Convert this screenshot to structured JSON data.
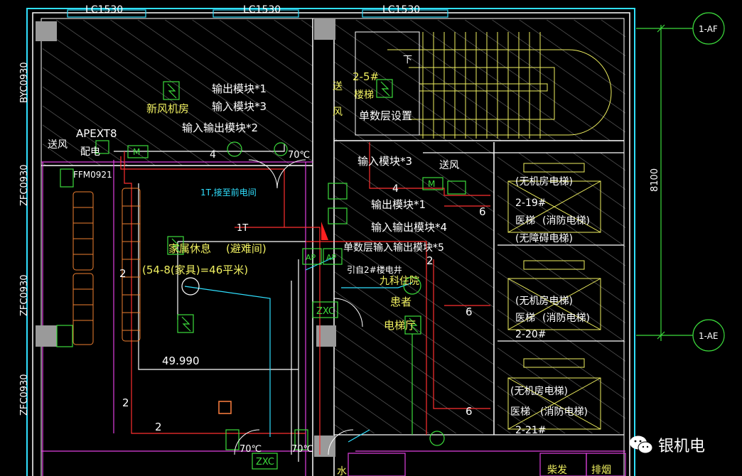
{
  "colors": {
    "background": "#000000",
    "wall": "#ffffff",
    "hatch": "#6b6b6b",
    "text_yellow": "#f0f060",
    "text_green": "#3cdc3c",
    "text_cyan": "#30e0ff",
    "text_white": "#ffffff",
    "magenta": "#e040e0",
    "red": "#ff3030",
    "dark_cyan": "#1aa6a6"
  },
  "windows": {
    "top": [
      "LC1530",
      "LC1530",
      "LC1530"
    ]
  },
  "left_labels": {
    "l1": "BYC0930",
    "l2": "ZFC0930",
    "l3": "ZFC0930",
    "l4": "ZFC0930",
    "l5": "ZFC0930"
  },
  "axes": {
    "a1": "1-AF",
    "a2": "1-AE",
    "dim": "8100"
  },
  "room_labels": {
    "xinfeng": "新风机房",
    "songfeng_left": "送风",
    "peidian": "配电",
    "apex": "APEXT8",
    "fm": "FFM0921",
    "jiashu": "家属休息",
    "bipan": "(避难间)",
    "area": "(54-8(家具)=46平米)",
    "elev_dim": "49.990",
    "songfeng_top": "送",
    "feng_top": "风",
    "stair_no": "2-5#",
    "louti": "楼梯",
    "xia": "下",
    "songfeng_mid": "送风",
    "huanzhe": "患者",
    "diantiting": "电梯厅",
    "jiyiyuan": "九科住院",
    "yindao": "引自2#楼电井",
    "t_route": "1T,接至前电间",
    "t_mark": "1T"
  },
  "notes": {
    "n1": "输出模块*1",
    "n2": "输入模块*3",
    "n3": "输入输出模块*2",
    "n4": "单数层设置",
    "n5": "输入模块*3",
    "n6": "输出模块*1",
    "n7": "输入输出模块*4",
    "n8": "单数层输入输出模块*5"
  },
  "temps": {
    "t1": "70℃",
    "t2": "70℃",
    "t3": "70℃"
  },
  "elevators": [
    {
      "type": "(无机房电梯)",
      "name": "医梯",
      "fire": "(消防电梯)",
      "no": "2-19#",
      "extra": "(无障碍电梯)"
    },
    {
      "type": "(无机房电梯)",
      "name": "医梯",
      "fire": "(消防电梯)",
      "no": "2-20#",
      "extra": ""
    },
    {
      "type": "(无机房电梯)",
      "name": "医梯",
      "fire": "(消防电梯)",
      "no": "2-21#",
      "extra": ""
    }
  ],
  "wire_counts": [
    "4",
    "4",
    "2",
    "2",
    "2",
    "2",
    "6",
    "6",
    "6"
  ],
  "equipment": {
    "zxc": "ZXC",
    "m": "M",
    "ap": "AP"
  },
  "bottom_labels": {
    "shui": "水",
    "chaifa": "柴发",
    "paiyan": "排烟"
  },
  "watermark": {
    "text": "银机电",
    "icon": "wechat-icon"
  }
}
